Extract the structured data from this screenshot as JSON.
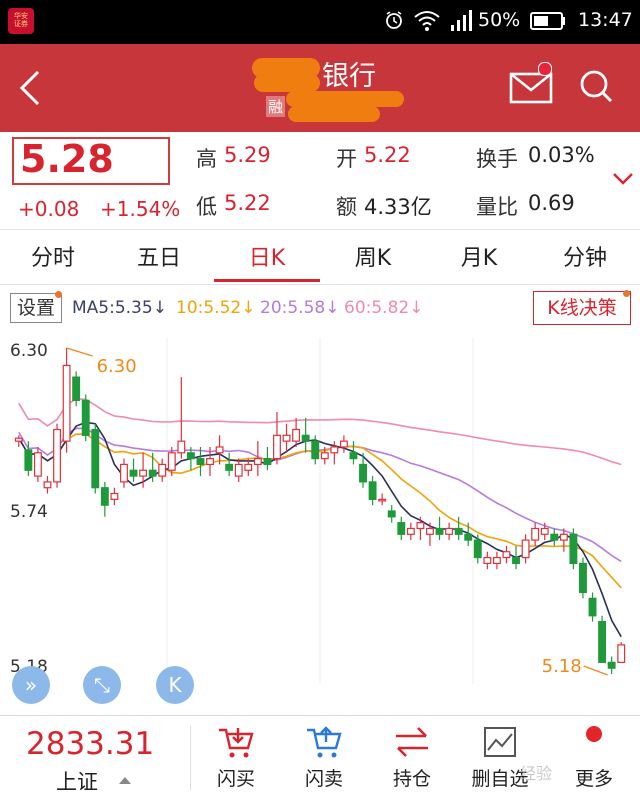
{
  "status_bar": {
    "app_icon_text": "华安\n证券",
    "battery_percent": "50%",
    "time": "13:47"
  },
  "header": {
    "title_suffix": "银行",
    "tag": "融"
  },
  "quote": {
    "price": "5.28",
    "change": "+0.08",
    "change_pct": "+1.54%",
    "fields": [
      {
        "label": "高",
        "value": "5.29",
        "color": "#d8242f"
      },
      {
        "label": "开",
        "value": "5.22",
        "color": "#d8242f"
      },
      {
        "label": "换手",
        "value": "0.03%",
        "color": "#222222"
      },
      {
        "label": "低",
        "value": "5.22",
        "color": "#d8242f"
      },
      {
        "label": "额",
        "value": "4.33亿",
        "color": "#222222"
      },
      {
        "label": "量比",
        "value": "0.69",
        "color": "#222222"
      }
    ]
  },
  "tabs": [
    "分时",
    "五日",
    "日K",
    "周K",
    "月K",
    "分钟"
  ],
  "active_tab": "日K",
  "ma_bar": {
    "settings_label": "设置",
    "items": [
      {
        "text": "MA5:5.35↓",
        "color": "#3a3f6a"
      },
      {
        "text": "10:5.52↓",
        "color": "#f0a30a"
      },
      {
        "text": "20:5.58↓",
        "color": "#b57be0"
      },
      {
        "text": "60:5.82↓",
        "color": "#f08ab0"
      }
    ],
    "kline_decision_label": "K线决策"
  },
  "chart_data": {
    "type": "candlestick",
    "y_axis_labels": [
      "6.30",
      "5.74",
      "5.18"
    ],
    "high_marker": "6.30",
    "low_marker": "5.18",
    "ylim": [
      5.18,
      6.3
    ],
    "candles": [
      [
        5.98,
        6.0,
        5.96,
        5.99
      ],
      [
        5.95,
        5.98,
        5.86,
        5.88
      ],
      [
        5.86,
        5.96,
        5.84,
        5.94
      ],
      [
        5.82,
        5.86,
        5.8,
        5.84
      ],
      [
        5.84,
        6.04,
        5.82,
        6.02
      ],
      [
        5.98,
        6.3,
        5.94,
        6.24
      ],
      [
        6.2,
        6.22,
        6.1,
        6.12
      ],
      [
        6.12,
        6.14,
        5.98,
        6.0
      ],
      [
        6.02,
        6.04,
        5.8,
        5.82
      ],
      [
        5.82,
        5.84,
        5.72,
        5.76
      ],
      [
        5.78,
        5.82,
        5.76,
        5.8
      ],
      [
        5.84,
        5.92,
        5.82,
        5.9
      ],
      [
        5.88,
        5.92,
        5.84,
        5.86
      ],
      [
        5.86,
        5.94,
        5.82,
        5.88
      ],
      [
        5.88,
        5.94,
        5.84,
        5.86
      ],
      [
        5.86,
        5.92,
        5.84,
        5.9
      ],
      [
        5.88,
        5.96,
        5.86,
        5.94
      ],
      [
        5.94,
        6.2,
        5.92,
        5.98
      ],
      [
        5.94,
        5.96,
        5.88,
        5.92
      ],
      [
        5.92,
        5.96,
        5.86,
        5.9
      ],
      [
        5.9,
        5.96,
        5.86,
        5.92
      ],
      [
        5.94,
        6.0,
        5.9,
        5.96
      ],
      [
        5.9,
        5.94,
        5.86,
        5.88
      ],
      [
        5.86,
        5.92,
        5.84,
        5.9
      ],
      [
        5.88,
        5.92,
        5.86,
        5.9
      ],
      [
        5.9,
        5.98,
        5.86,
        5.92
      ],
      [
        5.92,
        5.96,
        5.88,
        5.9
      ],
      [
        5.92,
        6.08,
        5.9,
        6.0
      ],
      [
        5.98,
        6.04,
        5.94,
        6.0
      ],
      [
        5.98,
        6.06,
        5.96,
        6.02
      ],
      [
        6.0,
        6.06,
        5.94,
        5.98
      ],
      [
        5.98,
        6.0,
        5.9,
        5.92
      ],
      [
        5.92,
        5.96,
        5.9,
        5.94
      ],
      [
        5.94,
        5.98,
        5.9,
        5.96
      ],
      [
        5.96,
        6.0,
        5.94,
        5.98
      ],
      [
        5.94,
        5.98,
        5.9,
        5.92
      ],
      [
        5.9,
        5.94,
        5.82,
        5.84
      ],
      [
        5.84,
        5.86,
        5.76,
        5.78
      ],
      [
        5.78,
        5.8,
        5.76,
        5.78
      ],
      [
        5.74,
        5.76,
        5.7,
        5.72
      ],
      [
        5.7,
        5.72,
        5.64,
        5.66
      ],
      [
        5.66,
        5.7,
        5.64,
        5.68
      ],
      [
        5.68,
        5.72,
        5.64,
        5.7
      ],
      [
        5.66,
        5.7,
        5.62,
        5.68
      ],
      [
        5.68,
        5.72,
        5.64,
        5.66
      ],
      [
        5.66,
        5.7,
        5.64,
        5.68
      ],
      [
        5.68,
        5.72,
        5.64,
        5.66
      ],
      [
        5.66,
        5.7,
        5.62,
        5.64
      ],
      [
        5.64,
        5.66,
        5.56,
        5.58
      ],
      [
        5.56,
        5.6,
        5.54,
        5.58
      ],
      [
        5.56,
        5.6,
        5.54,
        5.58
      ],
      [
        5.58,
        5.62,
        5.56,
        5.6
      ],
      [
        5.58,
        5.62,
        5.54,
        5.56
      ],
      [
        5.58,
        5.66,
        5.56,
        5.64
      ],
      [
        5.64,
        5.7,
        5.62,
        5.68
      ],
      [
        5.66,
        5.7,
        5.64,
        5.68
      ],
      [
        5.66,
        5.68,
        5.62,
        5.64
      ],
      [
        5.64,
        5.68,
        5.6,
        5.66
      ],
      [
        5.66,
        5.68,
        5.54,
        5.56
      ],
      [
        5.56,
        5.58,
        5.44,
        5.46
      ],
      [
        5.44,
        5.46,
        5.36,
        5.38
      ],
      [
        5.36,
        5.38,
        5.28,
        5.22
      ],
      [
        5.22,
        5.24,
        5.18,
        5.2
      ],
      [
        5.22,
        5.29,
        5.22,
        5.28
      ]
    ]
  },
  "chart_buttons": [
    "expand-icon",
    "fullscreen-icon",
    "k-icon"
  ],
  "bottom": {
    "index_value": "2833.31",
    "index_name": "上证",
    "actions": [
      {
        "label": "闪买",
        "icon": "buy-cart-icon"
      },
      {
        "label": "闪卖",
        "icon": "sell-cart-icon"
      },
      {
        "label": "持仓",
        "icon": "swap-arrows-icon"
      },
      {
        "label": "删自选",
        "icon": "delete-watchlist-icon"
      },
      {
        "label": "更多",
        "icon": "more-icon"
      }
    ],
    "watermark": "经验"
  }
}
